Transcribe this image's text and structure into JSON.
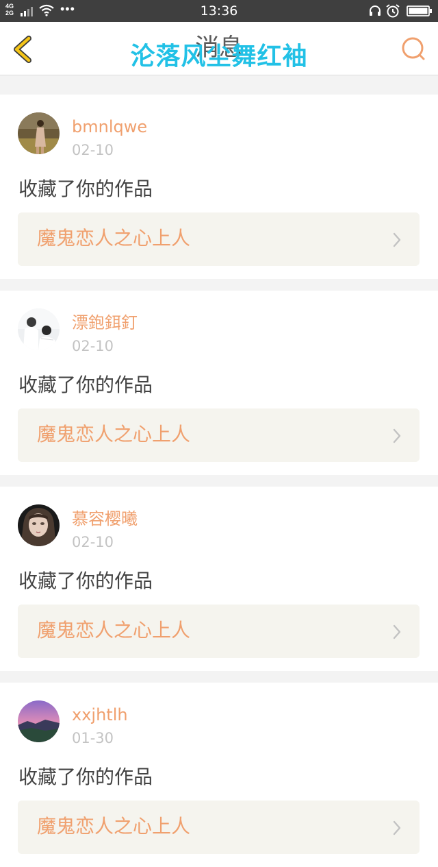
{
  "status_bar": {
    "network": "4G\n2G",
    "dots": "•••",
    "time": "13:36"
  },
  "header": {
    "title": "消息",
    "watermark": "沦落风尘舞红袖"
  },
  "colors": {
    "accent_orange": "#f0a06e",
    "back_icon_yellow": "#f5c518",
    "watermark_cyan": "#22c1e6",
    "work_box_bg": "#f5f4ee"
  },
  "messages": [
    {
      "username": "bmnlqwe",
      "date": "02-10",
      "action": "收藏了你的作品",
      "work_title": "魔鬼恋人之心上人"
    },
    {
      "username": "漂鉋鉺釘",
      "date": "02-10",
      "action": "收藏了你的作品",
      "work_title": "魔鬼恋人之心上人"
    },
    {
      "username": "慕容樱曦",
      "date": "02-10",
      "action": "收藏了你的作品",
      "work_title": "魔鬼恋人之心上人"
    },
    {
      "username": "xxjhtlh",
      "date": "01-30",
      "action": "收藏了你的作品",
      "work_title": "魔鬼恋人之心上人"
    }
  ]
}
